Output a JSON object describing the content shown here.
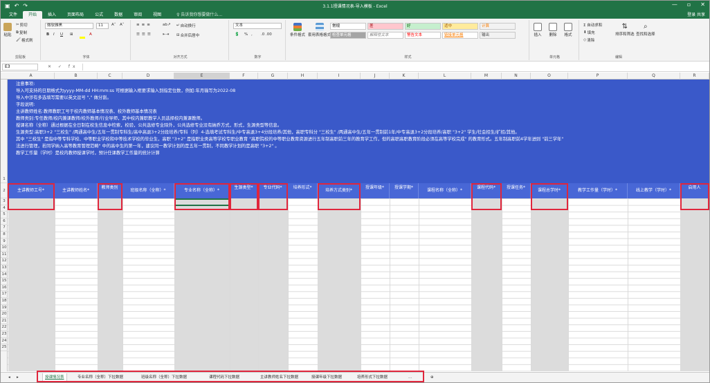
{
  "window": {
    "title": "3.1.1授课情况表-导入模板 - Excel",
    "minimize": "—",
    "restore": "▫",
    "close": "✕"
  },
  "qat": {
    "save": "▣",
    "undo": "↶",
    "redo": "↷"
  },
  "menu": {
    "tabs": [
      "文件",
      "开始",
      "插入",
      "页面布局",
      "公式",
      "数据",
      "审阅",
      "视图"
    ],
    "tellme": "♀ 告诉我你想要做什么...",
    "account": "登录  共享"
  },
  "ribbon": {
    "clipboard": {
      "label": "剪贴板",
      "paste": "粘贴",
      "cut": "剪切",
      "copy": "复制",
      "painter": "格式刷"
    },
    "font": {
      "label": "字体",
      "name": "微软雅黑",
      "size": "11",
      "grow": "A˄",
      "shrink": "A˅",
      "bold": "B",
      "italic": "I",
      "underline": "U"
    },
    "alignment": {
      "label": "对齐方式",
      "wrap": "自动换行",
      "merge": "合并后居中"
    },
    "number": {
      "label": "数字",
      "format": "文本",
      "percent": "%",
      "comma": ","
    },
    "styles": {
      "label": "样式",
      "cond": "条件格式",
      "table": "套用表格格式",
      "cells": [
        {
          "text": "常规",
          "bg": "#ffffff",
          "fg": "#000000"
        },
        {
          "text": "差",
          "bg": "#ffc7ce",
          "fg": "#9c0006"
        },
        {
          "text": "好",
          "bg": "#c6efce",
          "fg": "#006100"
        },
        {
          "text": "适中",
          "bg": "#ffeb9c",
          "fg": "#9c5700"
        },
        {
          "text": "计算",
          "bg": "#f2f2f2",
          "fg": "#fa7d00"
        },
        {
          "text": "检查单元格",
          "bg": "#a5a5a5",
          "fg": "#ffffff"
        },
        {
          "text": "解释性文本",
          "bg": "#ffffff",
          "fg": "#7f7f7f"
        },
        {
          "text": "警告文本",
          "bg": "#ffffff",
          "fg": "#ff0000"
        },
        {
          "text": "链接单元格",
          "bg": "#ffffff",
          "fg": "#fa7d00"
        },
        {
          "text": "输出",
          "bg": "#f2f2f2",
          "fg": "#3f3f3f"
        }
      ]
    },
    "cells": {
      "label": "单元格",
      "insert": "插入",
      "delete": "删除",
      "format": "格式"
    },
    "editing": {
      "label": "编辑",
      "autosum": "Σ 自动求和",
      "fill": "填充",
      "clear": "清除",
      "sort": "排序和筛选",
      "find": "查找和选择"
    }
  },
  "formula": {
    "namebox": "E3",
    "fx": "✕ ✓ fx",
    "value": ""
  },
  "columns": [
    "A",
    "B",
    "C",
    "D",
    "E",
    "F",
    "G",
    "H",
    "I",
    "J",
    "K",
    "L",
    "M",
    "N",
    "O",
    "P",
    "Q",
    "R"
  ],
  "rows": [
    "1",
    "2",
    "3",
    "4",
    "5",
    "6",
    "7",
    "8",
    "9",
    "10",
    "11",
    "12",
    "13",
    "14",
    "15",
    "16",
    "17",
    "18",
    "19",
    "20",
    "21",
    "22",
    "23",
    "24",
    "25"
  ],
  "notes": [
    "注意事项:",
    "导入可支持的日期格式为yyyy-MM-dd HH:mm:ss 可根据输入框要求输入到指定位数，例如:年月输写为2022-08",
    "导入中涉有多选填写需要以英文逗号 \",\" 做分割。",
    "字段说明:",
    "主讲教师姓名:教师教职工号于校内教师基本情况表、校外教师基本情况表",
    "教师类别:专任教师/校内兼课教师/校外教师/行业导师，其中校内兼职教学人员选择校内兼课教师。",
    "授课名称（全称）通过根据在全日制在校生信息中检索，校验，公共选修专业除外，公共选修专业没有納乔方式，形式，生源类型等信息。",
    "生源类型:高职3+2 \"三校生\" /两通高中生/五年一贯制专科生/高中高退3+2分段培养/专科（列）4-选填考试专科生/中专高退3+4分段培养/其他，高职专科分 \"三校生\" /两通高中生/五年一贯制前1年/中专高退3+2分段培养/高职 \"3+2\" 学生/社会招生/扩招/其他。",
    "其中 \"三校生\" 是指中等专科学校、中等职业学校和中等技术学校的毕业生，高职 \"3+2\" 是指职业类高等学校专职业教育 \"高职院校的中等职业教育资源进行五年制高职前三年的教育学工作，但的高职高职教育阶段必须在高等学校完成\" 的教育形式。五年制高职前4学年进则 \"前三学年\"",
    "法进行管理，若同学纳入高等教育管理范畴\" 中的高中生的第一年，建议同一教学计划的是五年一贯制，不同教学计划的是高职 \"3+2\" 。",
    "教学工作量（学时）是校内教师授课学时，预计任课教学工作量的统计计算"
  ],
  "headers": [
    {
      "label": "主讲教师工号*",
      "flagged": true
    },
    {
      "label": "主讲教师姓名*",
      "flagged": false
    },
    {
      "label": "教师类别",
      "flagged": true
    },
    {
      "label": "班级名称（全称）*",
      "flagged": false
    },
    {
      "label": "专业名称（全称）*",
      "flagged": true
    },
    {
      "label": "生源类型*",
      "flagged": true
    },
    {
      "label": "专业代码*",
      "flagged": true
    },
    {
      "label": "培养形式*",
      "flagged": false
    },
    {
      "label": "培养方式类别*",
      "flagged": true
    },
    {
      "label": "授课年级*",
      "flagged": false
    },
    {
      "label": "授课学期*",
      "flagged": false
    },
    {
      "label": "课程名称（全称）*",
      "flagged": false
    },
    {
      "label": "课程代码*",
      "flagged": true
    },
    {
      "label": "授课任务*",
      "flagged": false
    },
    {
      "label": "课程总学时*",
      "flagged": true
    },
    {
      "label": "教学工作量（学时）*",
      "flagged": false
    },
    {
      "label": "线上教学（学时）*",
      "flagged": false
    },
    {
      "label": "启用人",
      "flagged": true
    }
  ],
  "sheets": [
    {
      "name": "授课情况表",
      "active": true
    },
    {
      "name": "专业名称（全称）下拉数据",
      "active": false
    },
    {
      "name": "班级名称（全称）下拉数据",
      "active": false
    },
    {
      "name": "课程代码下拉数据",
      "active": false
    },
    {
      "name": "主讲教师姓名下拉数据",
      "active": false
    },
    {
      "name": "授课年级下拉数据",
      "active": false
    },
    {
      "name": "培养形式下拉数据",
      "active": false
    },
    {
      "name": "...",
      "active": false
    }
  ],
  "sheetnav": {
    "prev": "◂",
    "next": "▸",
    "add": "⊕"
  }
}
